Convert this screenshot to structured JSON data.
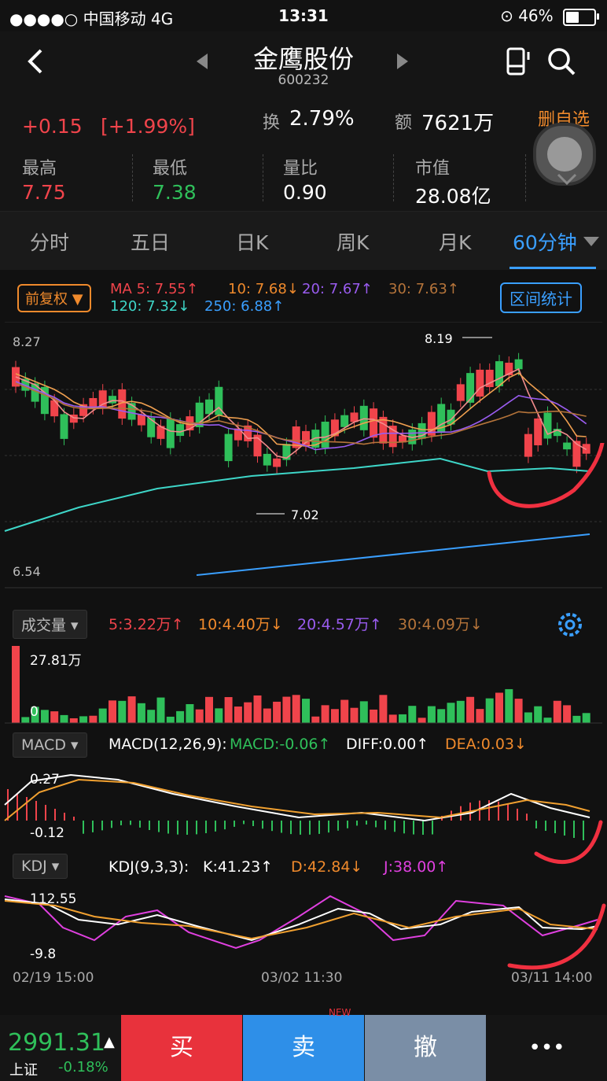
{
  "status": {
    "carrier": "●●●●○ 中国移动  4G",
    "time": "13:31",
    "battery": "46%"
  },
  "header": {
    "name": "金鹰股份",
    "code": "600232"
  },
  "quote": {
    "change": "+0.15",
    "change_pct": "[+1.99%]",
    "turnover_label": "换",
    "turnover": "2.79%",
    "amount_label": "额",
    "amount": "7621万",
    "fav": "删自选",
    "stats": [
      {
        "label": "最高",
        "value": "7.75"
      },
      {
        "label": "最低",
        "value": "7.38"
      },
      {
        "label": "量比",
        "value": "0.90"
      },
      {
        "label": "市值",
        "value": "28.08亿"
      }
    ]
  },
  "tabs": [
    "分时",
    "五日",
    "日K",
    "周K",
    "月K",
    "60分钟"
  ],
  "chart": {
    "adjust": "前复权 ▼",
    "range_btn": "区间统计",
    "ma": {
      "ma5": "MA 5: 7.55↑",
      "ma10": "10: 7.68↓",
      "ma20": "20: 7.67↑",
      "ma30": "30: 7.63↑",
      "ma120": "120: 7.32↓",
      "ma250": "250: 6.88↑"
    },
    "price_max": "8.27",
    "price_min": "6.54",
    "peak": "8.19",
    "trough": "7.02",
    "vol": {
      "label": "成交量",
      "v5": "5:3.22万↑",
      "v10": "10:4.40万↓",
      "v20": "20:4.57万↑",
      "v30": "30:4.09万↓",
      "max": "27.81万",
      "zero": "0"
    },
    "macd": {
      "label": "MACD",
      "params": "MACD(12,26,9):",
      "macd": "MACD:-0.06↑",
      "diff": "DIFF:0.00↑",
      "dea": "DEA:0.03↓",
      "max": "0.27",
      "min": "-0.12"
    },
    "kdj": {
      "label": "KDJ",
      "params": "KDJ(9,3,3):",
      "k": "K:41.23↑",
      "d": "D:42.84↓",
      "j": "J:38.00↑",
      "max": "112.55",
      "min": "-9.8"
    },
    "dates": [
      "02/19 15:00",
      "03/02 11:30",
      "03/11 14:00"
    ]
  },
  "bottom": {
    "index_value": "2991.31",
    "index_name": "上证",
    "index_change": "-0.18%",
    "buy": "买",
    "sell": "卖",
    "cancel": "撤",
    "more": "•••",
    "new_badge": "NEW"
  },
  "colors": {
    "up": "#f0444b",
    "down": "#2fbf5a",
    "accent": "#3a9fff",
    "orange": "#f08a2c"
  }
}
